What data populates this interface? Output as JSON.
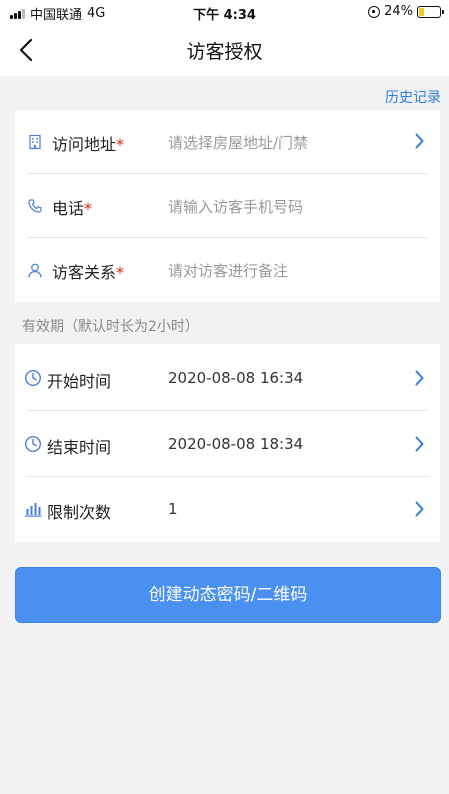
{
  "status_bar": {
    "carrier": "中国联通",
    "network": "4G",
    "time": "下午 4:34",
    "battery_percent": "24%",
    "battery_level": 0.24
  },
  "nav": {
    "title": "访客授权"
  },
  "history_link": "历史记录",
  "visitor_form": {
    "address": {
      "label": "访问地址",
      "required_mark": "*",
      "placeholder": "请选择房屋地址/门禁",
      "icon": "building-icon"
    },
    "phone": {
      "label": "电话",
      "required_mark": "*",
      "placeholder": "请输入访客手机号码",
      "icon": "phone-icon"
    },
    "relation": {
      "label": "访客关系",
      "required_mark": "*",
      "placeholder": "请对访客进行备注",
      "icon": "user-icon"
    }
  },
  "validity_section_label": "有效期（默认时长为2小时）",
  "validity": {
    "start": {
      "label": "开始时间",
      "value": "2020-08-08 16:34",
      "icon": "clock-icon"
    },
    "end": {
      "label": "结束时间",
      "value": "2020-08-08 18:34",
      "icon": "clock-icon"
    },
    "limit": {
      "label": "限制次数",
      "value": "1",
      "icon": "bar-chart-icon"
    }
  },
  "submit_button": "创建动态密码/二维码",
  "colors": {
    "accent": "#2f7de1",
    "button": "#4a90f0",
    "required": "#e02020",
    "battery": "#f3c623"
  }
}
